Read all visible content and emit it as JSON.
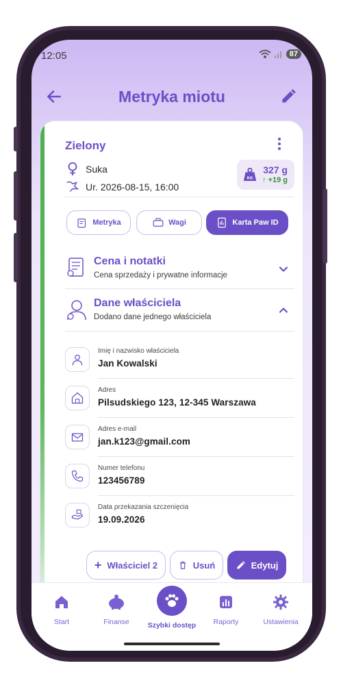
{
  "status_bar": {
    "time": "12:05",
    "battery": "87"
  },
  "app_bar": {
    "title": "Metryka miotu"
  },
  "card": {
    "name": "Zielony",
    "sex": "Suka",
    "birth": "Ur. 2026-08-15, 16:00",
    "weight": {
      "value": "327 g",
      "delta": "↑ +19 g",
      "unit_badge": "KG"
    },
    "tabs": [
      {
        "label": "Metryka"
      },
      {
        "label": "Wagi"
      },
      {
        "label": "Karta Paw ID"
      }
    ],
    "sections": [
      {
        "title": "Cena i notatki",
        "subtitle": "Cena sprzedaży i prywatne informacje"
      },
      {
        "title": "Dane właściciela",
        "subtitle": "Dodano dane jednego właściciela"
      }
    ],
    "owner": [
      {
        "label": "Imię i nazwisko właściciela",
        "value": "Jan Kowalski"
      },
      {
        "label": "Adres",
        "value": "Pilsudskiego 123, 12-345 Warszawa"
      },
      {
        "label": "Adres e-mail",
        "value": "jan.k123@gmail.com"
      },
      {
        "label": "Numer telefonu",
        "value": "123456789"
      },
      {
        "label": "Data przekazania szczenięcia",
        "value": "19.09.2026"
      }
    ],
    "actions": {
      "add_owner": "Właściciel 2",
      "delete": "Usuń",
      "edit": "Edytuj"
    }
  },
  "bottom_nav": [
    {
      "label": "Start"
    },
    {
      "label": "Finanse"
    },
    {
      "label": "Szybki dostęp"
    },
    {
      "label": "Raporty"
    },
    {
      "label": "Ustawienia"
    }
  ],
  "colors": {
    "accent": "#6b4fc6",
    "green": "#4caf50",
    "delta_green": "#3b8f3e"
  }
}
